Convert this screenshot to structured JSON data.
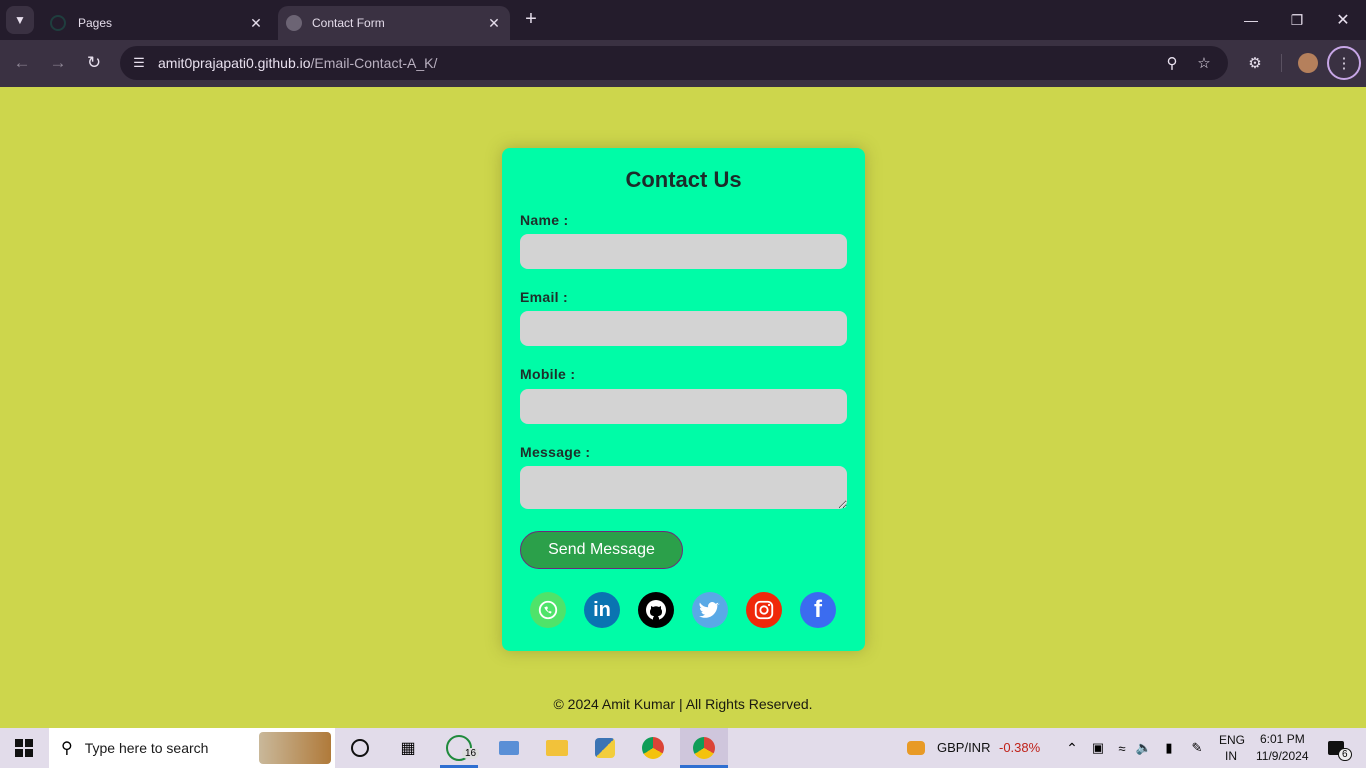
{
  "browser": {
    "tabs": [
      {
        "title": "Pages",
        "active": false
      },
      {
        "title": "Contact Form",
        "active": true
      }
    ],
    "url_host": "amit0prajapati0.github.io",
    "url_path": "/Email-Contact-A_K/"
  },
  "form": {
    "title": "Contact Us",
    "name_label": "Name :",
    "email_label": "Email :",
    "mobile_label": "Mobile :",
    "message_label": "Message :",
    "name_value": "",
    "email_value": "",
    "mobile_value": "",
    "message_value": "",
    "send_label": "Send Message"
  },
  "social": [
    {
      "name": "whatsapp-icon",
      "color": "#4fe36a"
    },
    {
      "name": "linkedin-icon",
      "color": "#0a74b1",
      "glyph": "in"
    },
    {
      "name": "github-icon",
      "color": "#000000"
    },
    {
      "name": "twitter-icon",
      "color": "#5aa9e6"
    },
    {
      "name": "instagram-icon",
      "color": "#f0280a"
    },
    {
      "name": "facebook-icon",
      "color": "#3b6cf0",
      "glyph": "f"
    }
  ],
  "footer": "© 2024 Amit Kumar | All Rights Reserved.",
  "colors": {
    "page_bg": "#cdd64c",
    "card_bg": "#00fca7",
    "button_bg": "#2ba04a"
  },
  "taskbar": {
    "search_placeholder": "Type here to search",
    "whatsapp_badge": "16",
    "ticker_label": "GBP/INR",
    "ticker_change": "-0.38%",
    "lang_top": "ENG",
    "lang_bottom": "IN",
    "time": "6:01 PM",
    "date": "11/9/2024",
    "notif_count": "6"
  }
}
